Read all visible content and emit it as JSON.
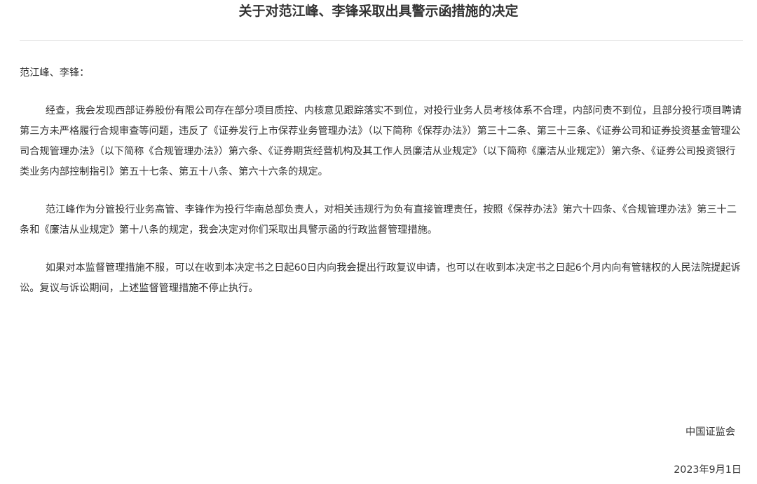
{
  "document": {
    "title": "关于对范江峰、李锋采取出具警示函措施的决定",
    "salutation": "范江峰、李锋：",
    "paragraphs": [
      "经查，我会发现西部证券股份有限公司存在部分项目质控、内核意见跟踪落实不到位，对投行业务人员考核体系不合理，内部问责不到位，且部分投行项目聘请第三方未严格履行合规审查等问题，违反了《证券发行上市保荐业务管理办法》（以下简称《保荐办法》）第三十二条、第三十三条、《证券公司和证券投资基金管理公司合规管理办法》（以下简称《合规管理办法》）第六条、《证券期货经营机构及其工作人员廉洁从业规定》（以下简称《廉洁从业规定》）第六条、《证券公司投资银行类业务内部控制指引》第五十七条、第五十八条、第六十六条的规定。",
      "范江峰作为分管投行业务高管、李锋作为投行华南总部负责人，对相关违规行为负有直接管理责任，按照《保荐办法》第六十四条、《合规管理办法》第三十二条和《廉洁从业规定》第十八条的规定，我会决定对你们采取出具警示函的行政监督管理措施。",
      "如果对本监督管理措施不服，可以在收到本决定书之日起60日内向我会提出行政复议申请，也可以在收到本决定书之日起6个月内向有管辖权的人民法院提起诉讼。复议与诉讼期间，上述监督管理措施不停止执行。"
    ],
    "signature": "中国证监会",
    "date": "2023年9月1日"
  }
}
